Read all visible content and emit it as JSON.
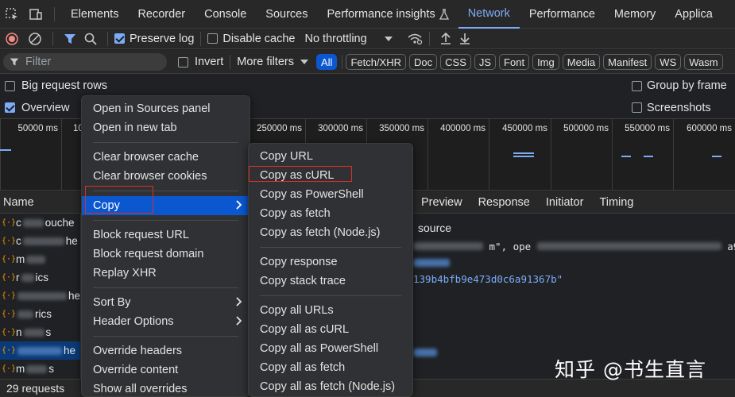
{
  "tabs": [
    {
      "label": "Elements"
    },
    {
      "label": "Recorder"
    },
    {
      "label": "Console"
    },
    {
      "label": "Sources"
    },
    {
      "label": "Performance insights"
    },
    {
      "label": "Network",
      "active": true
    },
    {
      "label": "Performance"
    },
    {
      "label": "Memory"
    },
    {
      "label": "Applica"
    }
  ],
  "toolbar": {
    "preserve_log": "Preserve log",
    "disable_cache": "Disable cache",
    "throttling": "No throttling"
  },
  "filter": {
    "placeholder": "Filter",
    "invert": "Invert",
    "more_filters": "More filters",
    "types": [
      "All",
      "Fetch/XHR",
      "Doc",
      "CSS",
      "JS",
      "Font",
      "Img",
      "Media",
      "Manifest",
      "WS",
      "Wasm"
    ]
  },
  "options": {
    "big_request_rows": "Big request rows",
    "overview": "Overview",
    "group_by_frame": "Group by frame",
    "screenshots": "Screenshots"
  },
  "timeline": {
    "ticks": [
      "50000 ms",
      "10",
      "250000 ms",
      "300000 ms",
      "350000 ms",
      "400000 ms",
      "450000 ms",
      "500000 ms",
      "550000 ms",
      "600000 ms"
    ]
  },
  "table": {
    "name_header": "Name",
    "detail_tabs": [
      "Preview",
      "Response",
      "Initiator",
      "Timing"
    ]
  },
  "requests": [
    {
      "name": "c",
      "suffix": "ouche"
    },
    {
      "name": "c",
      "suffix": "he"
    },
    {
      "name": "m",
      "suffix": ""
    },
    {
      "name": "r",
      "suffix": "ics"
    },
    {
      "name": "",
      "suffix": "he"
    },
    {
      "name": "",
      "suffix": "rics"
    },
    {
      "name": "n",
      "suffix": "s"
    },
    {
      "name": "",
      "suffix": "he",
      "selected": true
    },
    {
      "name": "m",
      "suffix": "s"
    }
  ],
  "details": {
    "line1": "source",
    "line2a": "m\", ope",
    "line2b": "a9",
    "line3": "139b4bfb9e473d0c6a91367b\""
  },
  "status": {
    "requests": "29 requests"
  },
  "context_menu": {
    "items": [
      "Open in Sources panel",
      "Open in new tab",
      "Clear browser cache",
      "Clear browser cookies",
      "Copy",
      "Block request URL",
      "Block request domain",
      "Replay XHR",
      "Sort By",
      "Header Options",
      "Override headers",
      "Override content",
      "Show all overrides"
    ]
  },
  "copy_submenu": {
    "items": [
      "Copy URL",
      "Copy as cURL",
      "Copy as PowerShell",
      "Copy as fetch",
      "Copy as fetch (Node.js)",
      "Copy response",
      "Copy stack trace",
      "Copy all URLs",
      "Copy all as cURL",
      "Copy all as PowerShell",
      "Copy all as fetch",
      "Copy all as fetch (Node.js)"
    ]
  },
  "watermark": "知乎 @书生直言",
  "colors": {
    "accent": "#7cacf8",
    "highlight": "#0b57d0",
    "record_red": "#f28b82",
    "annotation_red": "#d93025"
  }
}
